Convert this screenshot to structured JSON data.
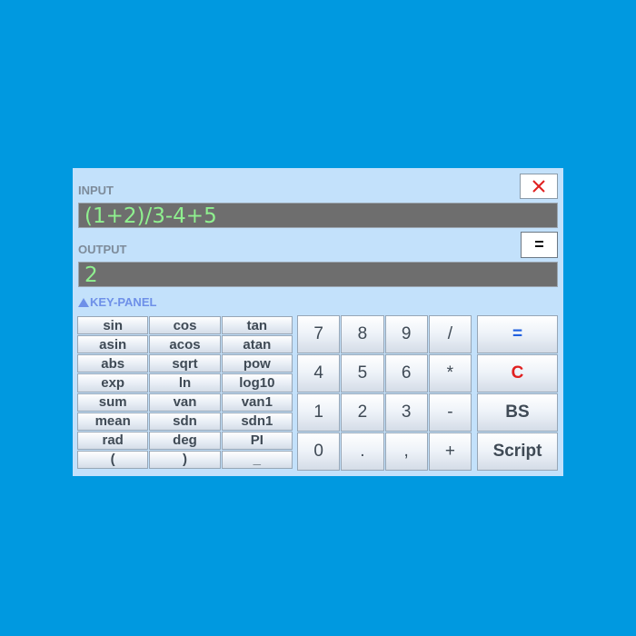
{
  "input": {
    "label": "INPUT",
    "value": "(1+2)/3-4+5"
  },
  "output": {
    "label": "OUTPUT",
    "value": "2"
  },
  "close_button": {
    "glyph": "×",
    "color": "#e02020"
  },
  "equals_small": {
    "label": "="
  },
  "key_panel": {
    "label": "KEY-PANEL",
    "accent": "#6e90e8"
  },
  "function_keys": [
    "sin",
    "cos",
    "tan",
    "asin",
    "acos",
    "atan",
    "abs",
    "sqrt",
    "pow",
    "exp",
    "ln",
    "log10",
    "sum",
    "van",
    "van1",
    "mean",
    "sdn",
    "sdn1",
    "rad",
    "deg",
    "PI",
    "(",
    ")",
    "_"
  ],
  "number_keys": [
    "7",
    "8",
    "9",
    "/",
    "4",
    "5",
    "6",
    "*",
    "1",
    "2",
    "3",
    "-",
    "0",
    ".",
    ",",
    "+"
  ],
  "big_keys": [
    {
      "label": "=",
      "color": "#2060e0"
    },
    {
      "label": "C",
      "color": "#e02020"
    },
    {
      "label": "BS",
      "color": "#3f4a55"
    },
    {
      "label": "Script",
      "color": "#3f4a55"
    }
  ]
}
